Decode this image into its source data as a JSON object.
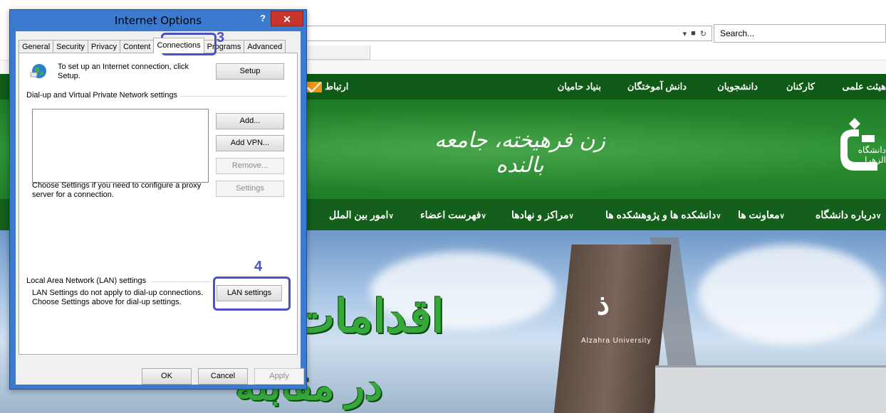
{
  "browser": {
    "search_placeholder": "Search...",
    "addr_dropdown": "▾",
    "lock": "🔒",
    "refresh": "↻"
  },
  "site": {
    "top_nav": [
      "هیئت علمی",
      "کارکنان",
      "دانشجویان",
      "دانش آموختگان",
      "بنیاد حامیان"
    ],
    "contact": "ارتباط",
    "slogan": "زن فرهیخته، جامعه بالنده",
    "logo_text": "دانشگاه الزهرا",
    "main_nav": [
      "درباره دانشگاه",
      "معاونت ها",
      "دانشکده ها و پژوهشکده ها",
      "مراکز و نهادها",
      "فهرست اعضاء",
      "امور بین الملل"
    ],
    "hero_line1": "اقدامات",
    "hero_line2": "در مقابله",
    "tower_caption": "Alzahra University",
    "tower_logo": "ذ"
  },
  "dialog": {
    "title": "Internet Options",
    "help": "?",
    "close": "✕",
    "tabs": [
      "General",
      "Security",
      "Privacy",
      "Content",
      "Connections",
      "Programs",
      "Advanced"
    ],
    "active_tab": "Connections",
    "setup_text": "To set up an Internet connection, click Setup.",
    "setup_button": "Setup",
    "dialup_group": "Dial-up and Virtual Private Network settings",
    "add_button": "Add...",
    "add_vpn_button": "Add VPN...",
    "remove_button": "Remove...",
    "proxy_text": "Choose Settings if you need to configure a proxy server for a connection.",
    "settings_button": "Settings",
    "lan_group": "Local Area Network (LAN) settings",
    "lan_text": "LAN Settings do not apply to dial-up connections. Choose Settings above for dial-up settings.",
    "lan_button": "LAN settings",
    "ok": "OK",
    "cancel": "Cancel",
    "apply": "Apply"
  },
  "annotations": {
    "step3": "3",
    "step4": "4",
    "color": "#4a50c8"
  }
}
